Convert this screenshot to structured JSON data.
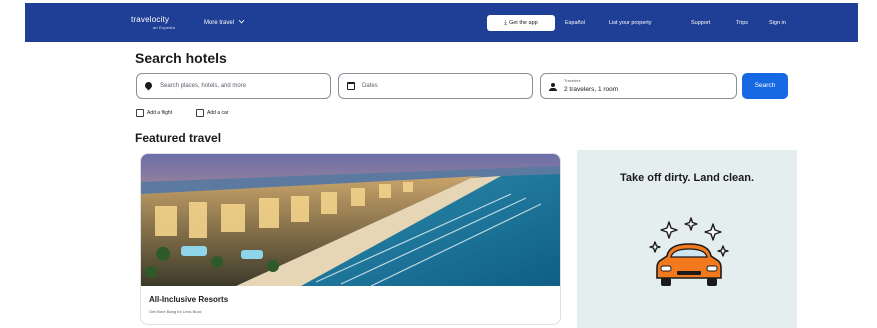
{
  "header": {
    "logo_text": "travelocity",
    "logo_tagline": "an Expedia",
    "more_travel": "More travel",
    "get_app": "Get the app",
    "links": [
      "Español",
      "List your property",
      "Support",
      "Trips",
      "Sign in"
    ]
  },
  "search": {
    "heading": "Search hotels",
    "destination_placeholder": "Search places, hotels, and more",
    "dates_placeholder": "Dates",
    "travelers_label": "Travelers",
    "travelers_value": "2 travelers, 1 room",
    "search_button": "Search",
    "add_flight": "Add a flight",
    "add_car": "Add a car"
  },
  "featured": {
    "heading": "Featured travel",
    "card_title": "All-Inclusive Resorts",
    "card_subtitle": "Get More Bang for Less Buck"
  },
  "ad": {
    "headline": "Take off dirty. Land clean."
  },
  "colors": {
    "header_bg": "#1f3f96",
    "accent": "#1668e3",
    "ad_bg": "#e4eeee",
    "car": "#f2791e"
  },
  "icons": [
    "download-icon",
    "chevron-down-icon",
    "map-pin-icon",
    "calendar-icon",
    "person-icon",
    "checkbox-icon",
    "car-sparkle-icon"
  ]
}
